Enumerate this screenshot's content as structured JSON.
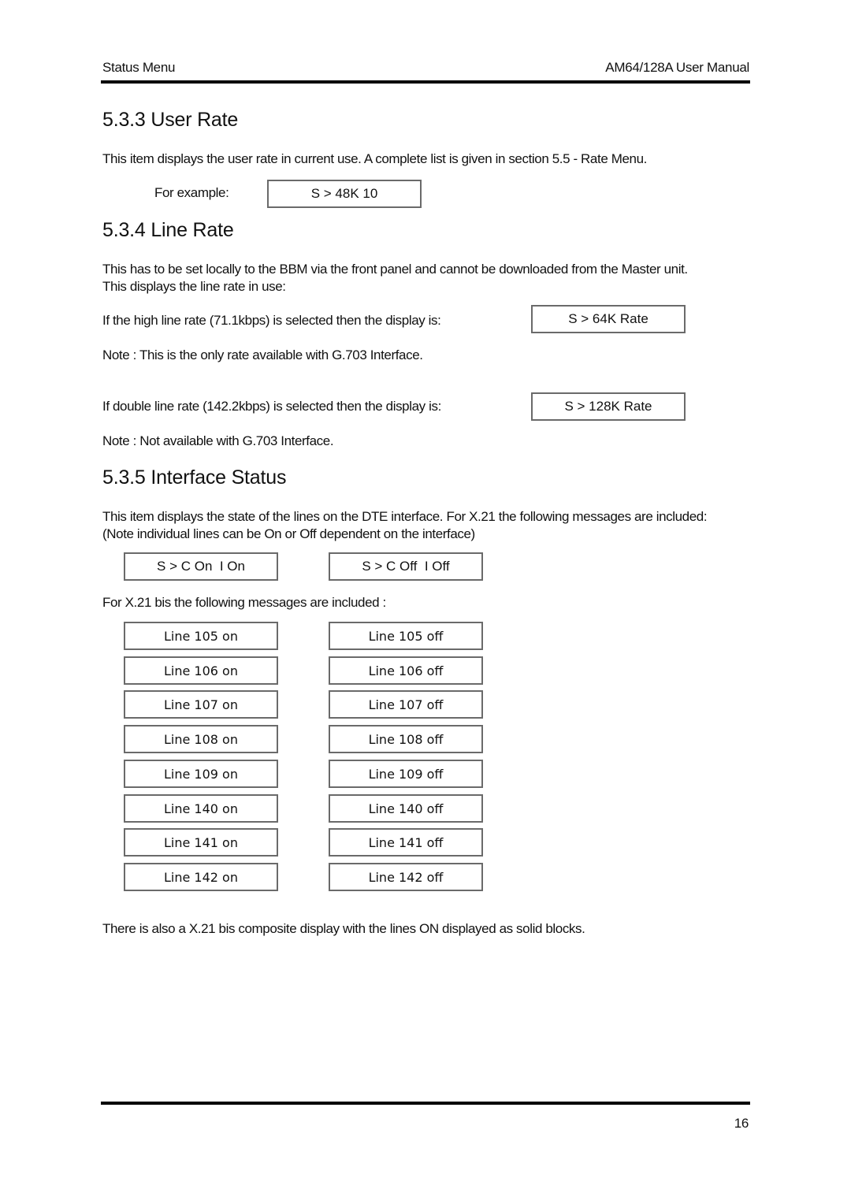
{
  "header": {
    "left": "Status Menu",
    "right": "AM64/128A User Manual"
  },
  "section_533": {
    "title": "5.3.3 User Rate",
    "body": "This item displays the user rate in current use. A complete list is given in section 5.5 - Rate Menu.",
    "example_label": "For example:",
    "example_display": "S > 48K 10"
  },
  "section_534": {
    "title": "5.3.4 Line Rate",
    "body_line1": "This has to be set locally to the BBM via the front panel and cannot be downloaded from the Master unit.",
    "body_line2": "This displays the line rate in use:",
    "high_rate_text": "If the high line rate (71.1kbps) is selected then the display is:",
    "high_rate_display": "S > 64K Rate",
    "high_rate_note": "Note : This is the only rate available with G.703 Interface.",
    "double_rate_text": "If double line rate (142.2kbps) is selected then the display is:",
    "double_rate_display": "S > 128K Rate",
    "double_rate_note": "Note : Not available with G.703 Interface."
  },
  "section_535": {
    "title": "5.3.5 Interface Status",
    "body_line1": "This item displays the state of the lines on the DTE interface. For X.21 the following messages are included:",
    "body_line2": "(Note individual lines can be On or Off dependent on the interface)",
    "x21_on": "S > C On  I On",
    "x21_off": "S > C Off  I Off",
    "x21bis_intro": "For X.21 bis the following messages are included :",
    "x21bis_lines": [
      {
        "on": "Line 105 on",
        "off": "Line 105 off"
      },
      {
        "on": "Line 106 on",
        "off": "Line 106 off"
      },
      {
        "on": "Line 107 on",
        "off": "Line 107 off"
      },
      {
        "on": "Line 108 on",
        "off": "Line 108 off"
      },
      {
        "on": "Line 109 on",
        "off": "Line 109 off"
      },
      {
        "on": "Line 140 on",
        "off": "Line 140 off"
      },
      {
        "on": "Line 141 on",
        "off": "Line 141 off"
      },
      {
        "on": "Line 142 on",
        "off": "Line 142 off"
      }
    ],
    "composite_note": "There is also a X.21 bis composite display with the lines ON displayed as solid blocks."
  },
  "footer": {
    "page_number": "16"
  }
}
